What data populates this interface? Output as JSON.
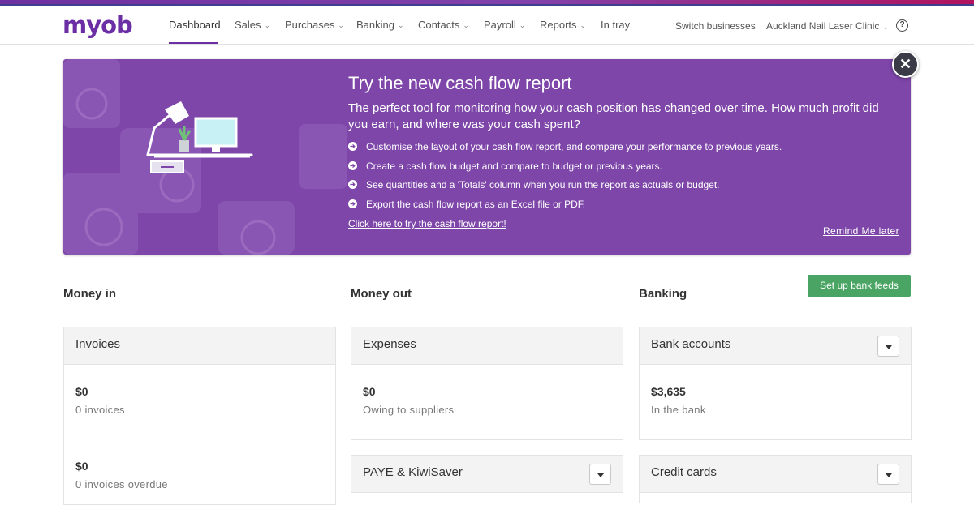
{
  "brand": {
    "logo_text": "myob"
  },
  "nav": {
    "items": [
      {
        "label": "Dashboard",
        "active": true,
        "has_menu": false
      },
      {
        "label": "Sales",
        "has_menu": true
      },
      {
        "label": "Purchases",
        "has_menu": true
      },
      {
        "label": "Banking",
        "has_menu": true
      },
      {
        "label": "Contacts",
        "has_menu": true
      },
      {
        "label": "Payroll",
        "has_menu": true
      },
      {
        "label": "Reports",
        "has_menu": true
      },
      {
        "label": "In tray",
        "has_menu": false
      }
    ],
    "switch_businesses": "Switch businesses",
    "business_name": "Auckland Nail Laser Clinic",
    "help_icon": "help-circle-icon",
    "chevron": "⌄"
  },
  "banner": {
    "title": "Try the new cash flow report",
    "subtitle": "The perfect tool for monitoring how your cash position has changed over time. How much profit did you earn, and where was your cash spent?",
    "bullets": [
      "Customise the layout of your cash flow report, and compare your performance to previous years.",
      "Create a cash flow budget and compare to budget or previous years.",
      "See quantities and a 'Totals' column when you run the report as actuals or budget.",
      "Export the cash flow report as an Excel file or PDF."
    ],
    "cta_link": "Click here to try the cash flow report!",
    "remind_link": "Remind Me later",
    "close_symbol": "✕",
    "colors": {
      "background": "#7d46a8"
    }
  },
  "sections": {
    "money_in": "Money in",
    "money_out": "Money out",
    "banking": "Banking",
    "setup_bank_feeds": "Set up bank feeds"
  },
  "cards": {
    "invoices": {
      "title": "Invoices",
      "amount": "$0",
      "desc": "0 invoices",
      "amount2": "$0",
      "desc2": "0 invoices overdue"
    },
    "expenses": {
      "title": "Expenses",
      "amount": "$0",
      "desc": "Owing to suppliers"
    },
    "paye": {
      "title": "PAYE & KiwiSaver"
    },
    "bank_accounts": {
      "title": "Bank accounts",
      "amount": "$3,635",
      "desc": "In the bank"
    },
    "credit_cards": {
      "title": "Credit cards"
    }
  },
  "colors": {
    "brand": "#6b2ea5",
    "accent_green": "#4aa564"
  }
}
